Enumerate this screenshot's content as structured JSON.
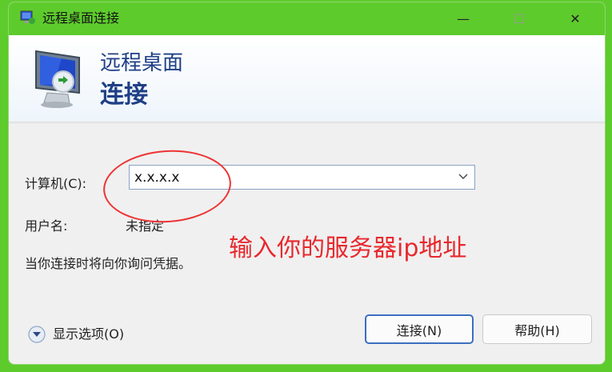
{
  "window": {
    "title": "远程桌面连接",
    "controls": {
      "minimize": "—",
      "maximize": "☐",
      "close": "✕"
    }
  },
  "header": {
    "line1": "远程桌面",
    "line2": "连接"
  },
  "form": {
    "computer_label": "计算机(C):",
    "computer_value": "x.x.x.x",
    "user_label": "用户名:",
    "user_value": "未指定",
    "credential_note": "当你连接时将向你询问凭据。"
  },
  "annotation": {
    "text": "输入你的服务器ip地址",
    "color": "#e8282e"
  },
  "footer": {
    "options_label": "显示选项(O)",
    "connect_button": "连接(N)",
    "help_button": "帮助(H)"
  },
  "colors": {
    "frame_green": "#5ecb2d",
    "title_blue": "#1f3f86",
    "dialog_bg": "#f0f0f0"
  }
}
